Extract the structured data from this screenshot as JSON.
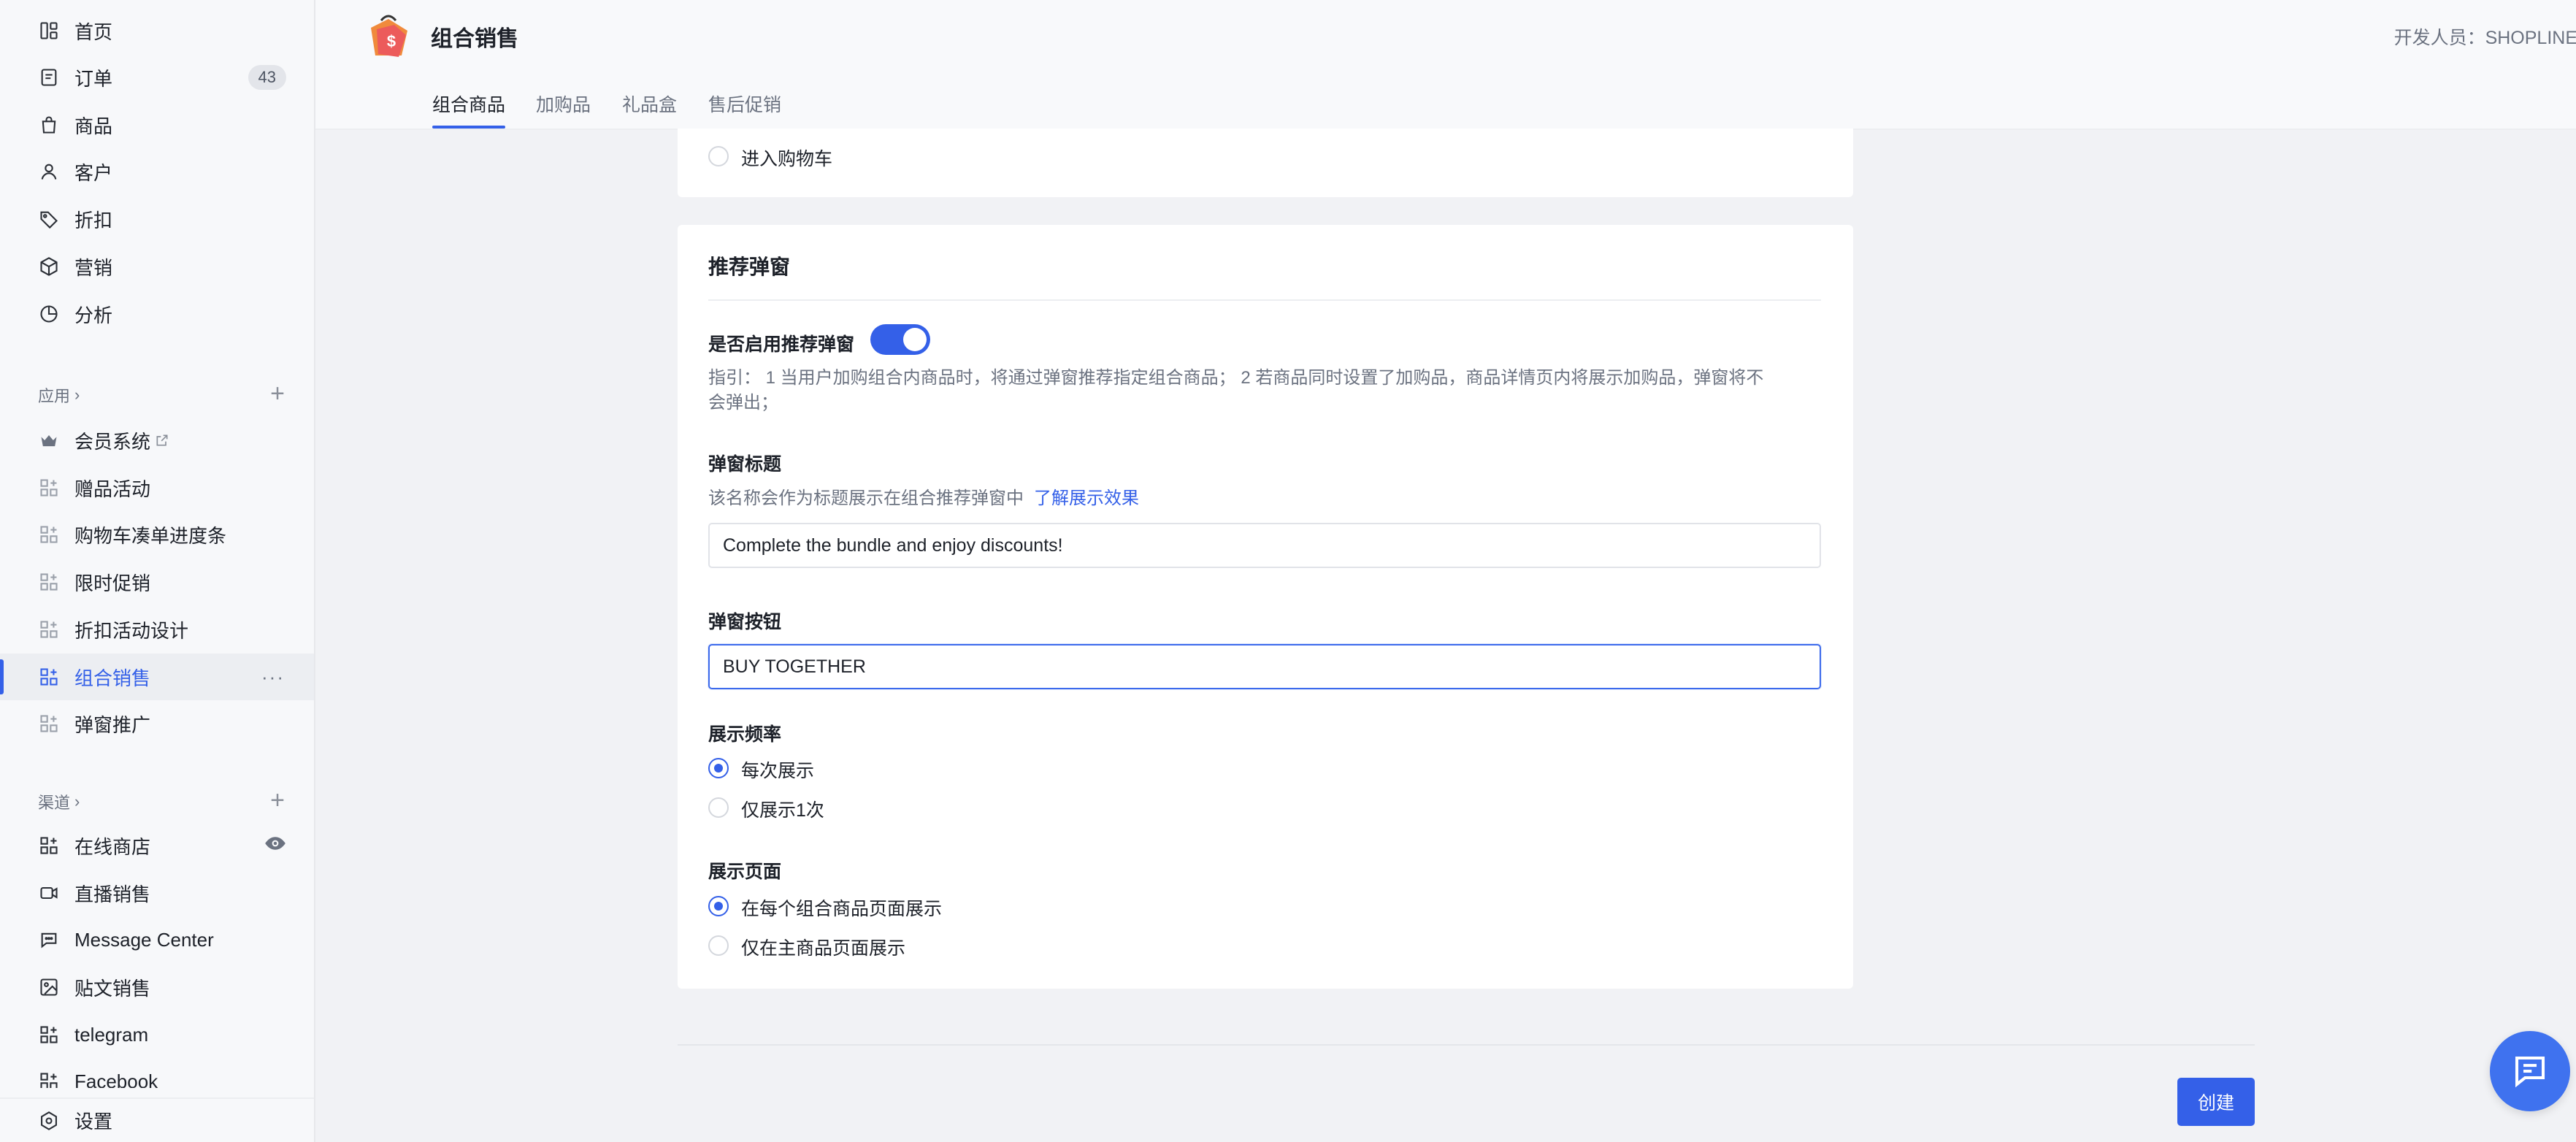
{
  "sidebar": {
    "main_items": [
      {
        "label": "首页",
        "icon": "dashboard-icon"
      },
      {
        "label": "订单",
        "icon": "order-icon",
        "badge": "43"
      },
      {
        "label": "商品",
        "icon": "bag-icon"
      },
      {
        "label": "客户",
        "icon": "user-icon"
      },
      {
        "label": "折扣",
        "icon": "tag-icon"
      },
      {
        "label": "营销",
        "icon": "cube-icon"
      },
      {
        "label": "分析",
        "icon": "pie-chart-icon"
      }
    ],
    "apps_section": "应用",
    "apps": [
      {
        "label": "会员系统",
        "icon": "crown-icon",
        "external": true
      },
      {
        "label": "赠品活动",
        "icon": "app-grid-icon"
      },
      {
        "label": "购物车凑单进度条",
        "icon": "app-grid-icon"
      },
      {
        "label": "限时促销",
        "icon": "app-grid-icon"
      },
      {
        "label": "折扣活动设计",
        "icon": "app-grid-icon"
      },
      {
        "label": "组合销售",
        "icon": "app-grid-icon",
        "active": true
      },
      {
        "label": "弹窗推广",
        "icon": "app-grid-icon"
      }
    ],
    "channels_section": "渠道",
    "channels": [
      {
        "label": "在线商店",
        "icon": "app-grid-icon",
        "eye": true
      },
      {
        "label": "直播销售",
        "icon": "video-icon"
      },
      {
        "label": "Message Center",
        "icon": "chat-icon"
      },
      {
        "label": "贴文销售",
        "icon": "image-icon"
      },
      {
        "label": "telegram",
        "icon": "app-grid-icon"
      },
      {
        "label": "Facebook",
        "icon": "app-grid-icon"
      }
    ],
    "settings": "设置"
  },
  "header": {
    "title": "组合销售",
    "developer": "开发人员：SHOPLINE",
    "tabs": [
      "组合商品",
      "加购品",
      "礼品盒",
      "售后促销"
    ],
    "active_tab": "组合商品"
  },
  "top_card": {
    "option_label": "进入购物车"
  },
  "popup_card": {
    "title": "推荐弹窗",
    "enable_label": "是否启用推荐弹窗",
    "enabled": true,
    "guide_line1": "指引：  1 当用户加购组合内商品时，将通过弹窗推荐指定组合商品；  2 若商品同时设置了加购品，商品详情页内将展示加购品，弹窗将不",
    "guide_line2": "会弹出；",
    "popup_title_label": "弹窗标题",
    "popup_title_hint": "该名称会作为标题展示在组合推荐弹窗中",
    "popup_title_link": "了解展示效果",
    "popup_title_value": "Complete the bundle and enjoy discounts!",
    "popup_button_label": "弹窗按钮",
    "popup_button_value": "BUY TOGETHER",
    "frequency_label": "展示频率",
    "frequency_options": [
      "每次展示",
      "仅展示1次"
    ],
    "frequency_selected": 0,
    "page_label": "展示页面",
    "page_options": [
      "在每个组合商品页面展示",
      "仅在主商品页面展示"
    ],
    "page_selected": 0
  },
  "footer": {
    "create_label": "创建"
  },
  "colors": {
    "accent": "#3460e8",
    "sidebar_bg": "#f7f8fa",
    "page_bg": "#f1f2f5"
  }
}
